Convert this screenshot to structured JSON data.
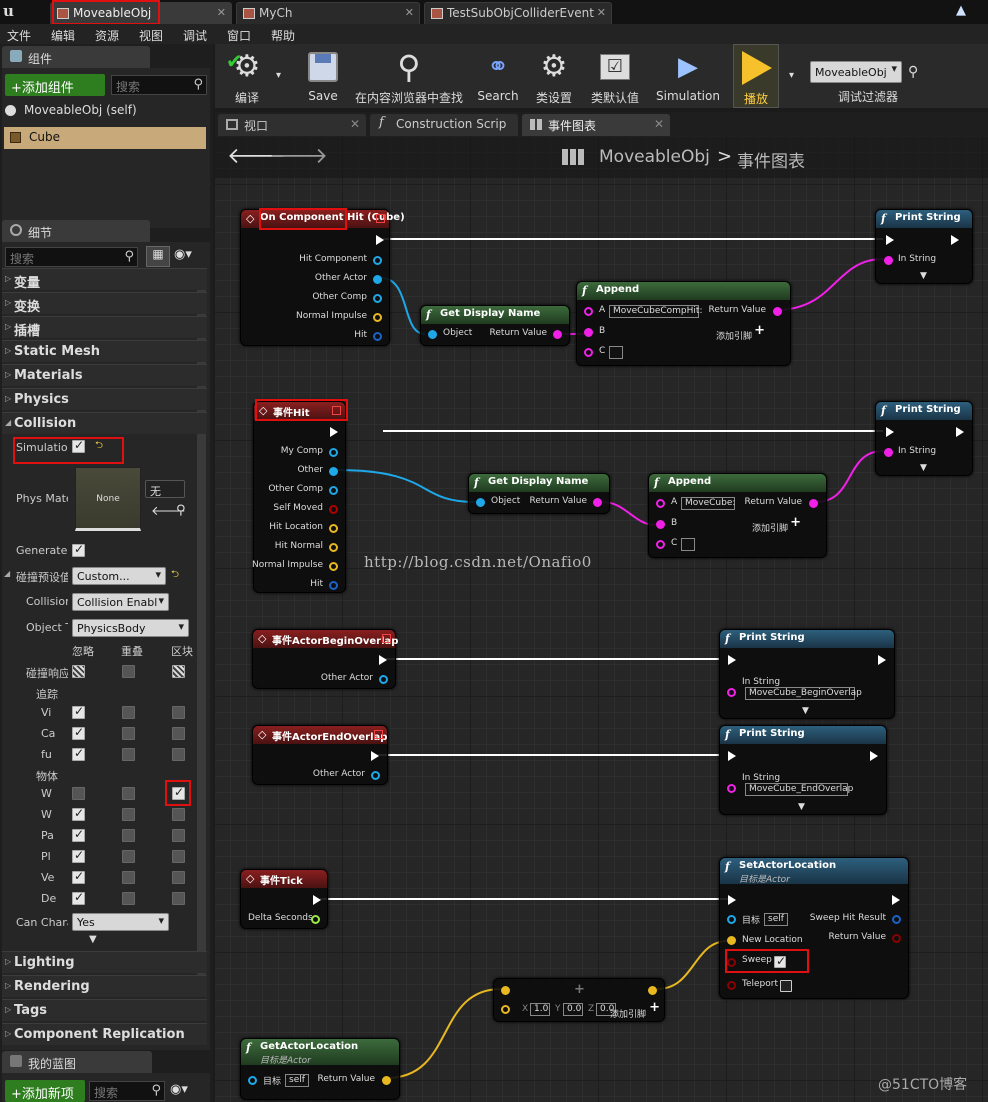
{
  "tabs": [
    {
      "label": "MoveableObj",
      "active": true
    },
    {
      "label": "MyCh",
      "active": false
    },
    {
      "label": "TestSubObjColliderEvent",
      "active": false
    }
  ],
  "menu": [
    "文件",
    "编辑",
    "资源",
    "视图",
    "调试",
    "窗口",
    "帮助"
  ],
  "components": {
    "tab_label": "组件",
    "add_button": "+添加组件",
    "search_placeholder": "搜索",
    "self_item": "MoveableObj (self)",
    "cube_item": "Cube"
  },
  "details": {
    "tab_label": "细节",
    "search_placeholder": "搜索",
    "categories_top": [
      "变量",
      "变换",
      "插槽",
      "Static Mesh",
      "Materials",
      "Physics",
      "Collision"
    ],
    "simulation_label": "Simulation",
    "phys_material_label": "Phys Mate",
    "phys_material_thumb": "None",
    "phys_material_combo": "无",
    "generate_label": "Generate C",
    "preset_label": "碰撞预设值",
    "preset_value": "Custom...",
    "collision_label": "Collision",
    "collision_value": "Collision Enabl",
    "object_type_label": "Object T",
    "object_type_value": "PhysicsBody",
    "resp_headers": [
      "忽略",
      "重叠",
      "区块"
    ],
    "response_label": "碰撞响应",
    "trace_label": "追踪",
    "trace_rows": [
      "Vi",
      "Ca",
      "fu"
    ],
    "object_label": "物体",
    "object_rows": [
      "W",
      "W",
      "Pa",
      "Pl",
      "Ve",
      "De"
    ],
    "can_char_label": "Can Chara",
    "can_char_value": "Yes",
    "categories_bottom": [
      "Lighting",
      "Rendering",
      "Tags",
      "Component Replication"
    ]
  },
  "my_blueprint": {
    "tab_label": "我的蓝图",
    "add_button": "+添加新项",
    "search_placeholder": "搜索"
  },
  "toolbar": {
    "items": [
      {
        "label": "编译",
        "icon": "compile-icon"
      },
      {
        "label": "Save",
        "icon": "save-icon"
      },
      {
        "label": "在内容浏览器中查找",
        "icon": "find-in-browser-icon"
      },
      {
        "label": "Search",
        "icon": "binoculars-icon"
      },
      {
        "label": "类设置",
        "icon": "class-settings-icon"
      },
      {
        "label": "类默认值",
        "icon": "class-defaults-icon"
      },
      {
        "label": "Simulation",
        "icon": "simulation-icon"
      },
      {
        "label": "播放",
        "icon": "play-icon"
      }
    ],
    "debug_filter_value": "MoveableObj",
    "debug_filter_label": "调试过滤器"
  },
  "graph_tabs": [
    {
      "label": "视口",
      "active": false
    },
    {
      "label": "Construction Scrip",
      "active": false
    },
    {
      "label": "事件图表",
      "active": true
    }
  ],
  "breadcrumb": {
    "root": "MoveableObj",
    "sep": ">",
    "current": "事件图表"
  },
  "nodes": {
    "hit_cube": {
      "title": "On Component Hit (Cube)",
      "pins": [
        "Hit Component",
        "Other Actor",
        "Other Comp",
        "Normal Impulse",
        "Hit"
      ]
    },
    "gdn1": {
      "title": "Get Display Name",
      "in": "Object",
      "out": "Return Value"
    },
    "append1": {
      "title": "Append",
      "a": "A",
      "a_value": "MoveCubeCompHit:",
      "b": "B",
      "c": "C",
      "out": "Return Value",
      "add": "添加引脚"
    },
    "ps1": {
      "title": "Print String",
      "in": "In String"
    },
    "event_hit": {
      "title": "事件Hit",
      "pins": [
        "My Comp",
        "Other",
        "Other Comp",
        "Self Moved",
        "Hit Location",
        "Hit Normal",
        "Normal Impulse",
        "Hit"
      ]
    },
    "gdn2": {
      "title": "Get Display Name",
      "in": "Object",
      "out": "Return Value"
    },
    "append2": {
      "title": "Append",
      "a": "A",
      "a_value": "MoveCube:",
      "b": "B",
      "c": "C",
      "out": "Return Value",
      "add": "添加引脚"
    },
    "ps2": {
      "title": "Print String",
      "in": "In String"
    },
    "begin_overlap": {
      "title": "事件ActorBeginOverlap",
      "pin": "Other Actor"
    },
    "ps3": {
      "title": "Print String",
      "in": "In String",
      "value": "MoveCube_BeginOverlap"
    },
    "end_overlap": {
      "title": "事件ActorEndOverlap",
      "pin": "Other Actor"
    },
    "ps4": {
      "title": "Print String",
      "in": "In String",
      "value": "MoveCube_EndOverlap"
    },
    "tick": {
      "title": "事件Tick",
      "pin": "Delta Seconds"
    },
    "set_loc": {
      "title": "SetActorLocation",
      "subtitle": "目标是Actor",
      "target": "目标",
      "self": "self",
      "new_location": "New Location",
      "sweep": "Sweep",
      "teleport": "Teleport",
      "sweep_hit": "Sweep Hit Result",
      "ret": "Return Value"
    },
    "add_vec": {
      "x_label": "X",
      "x": "1.0",
      "y_label": "Y",
      "y": "0.0",
      "z_label": "Z",
      "z": "0.0",
      "add": "添加引脚"
    },
    "get_loc": {
      "title": "GetActorLocation",
      "subtitle": "目标是Actor",
      "target": "目标",
      "self": "self",
      "ret": "Return Value"
    }
  },
  "watermark": "http://blog.csdn.net/Onafio0",
  "corner_watermark": "@51CTO博客",
  "colors": {
    "object_pin": "#1ea8e8",
    "string_pin": "#f020e8",
    "struct_pin": "#e8b820",
    "bool_pin": "#8b0000",
    "float_pin": "#9ce846",
    "highlight": "#e01010"
  }
}
